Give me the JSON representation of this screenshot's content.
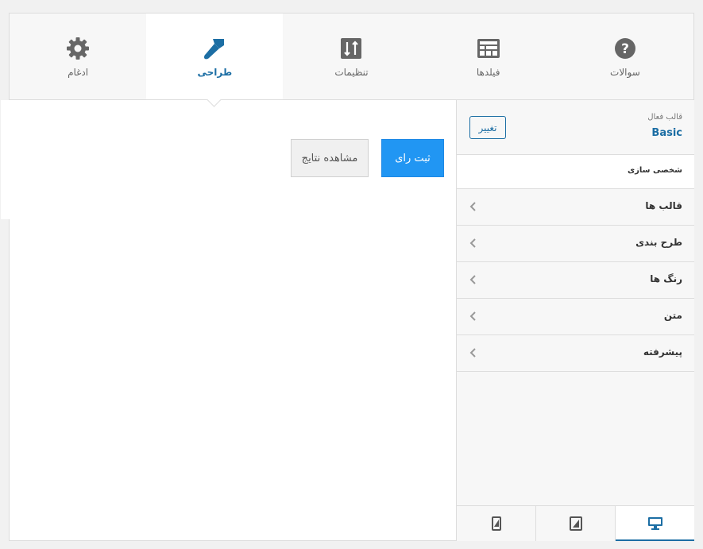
{
  "tabs": [
    {
      "id": "questions",
      "label": "سوالات",
      "icon": "question-circle-icon"
    },
    {
      "id": "fields",
      "label": "فیلدها",
      "icon": "table-layout-icon"
    },
    {
      "id": "settings",
      "label": "تنظیمات",
      "icon": "sort-settings-icon"
    },
    {
      "id": "design",
      "label": "طراحی",
      "icon": "paint-brush-icon",
      "active": true
    },
    {
      "id": "integration",
      "label": "ادغام",
      "icon": "gear-icon"
    }
  ],
  "preview": {
    "submit_label": "ثبت رای",
    "results_label": "مشاهده نتایج"
  },
  "sidebar": {
    "active_theme_label": "قالب فعال",
    "active_theme_name": "Basic",
    "change_label": "تغییر",
    "customize_heading": "شخصی سازی",
    "items": [
      {
        "label": "قالب ها"
      },
      {
        "label": "طرح بندی"
      },
      {
        "label": "رنگ ها"
      },
      {
        "label": "متن"
      },
      {
        "label": "پیشرفته"
      }
    ]
  },
  "devices": [
    {
      "id": "desktop",
      "icon": "desktop-icon",
      "active": true
    },
    {
      "id": "tablet",
      "icon": "tablet-icon"
    },
    {
      "id": "mobile",
      "icon": "mobile-icon"
    }
  ],
  "colors": {
    "accent": "#1c6ea4",
    "submit": "#2196f3",
    "icon_gray": "#666666"
  }
}
